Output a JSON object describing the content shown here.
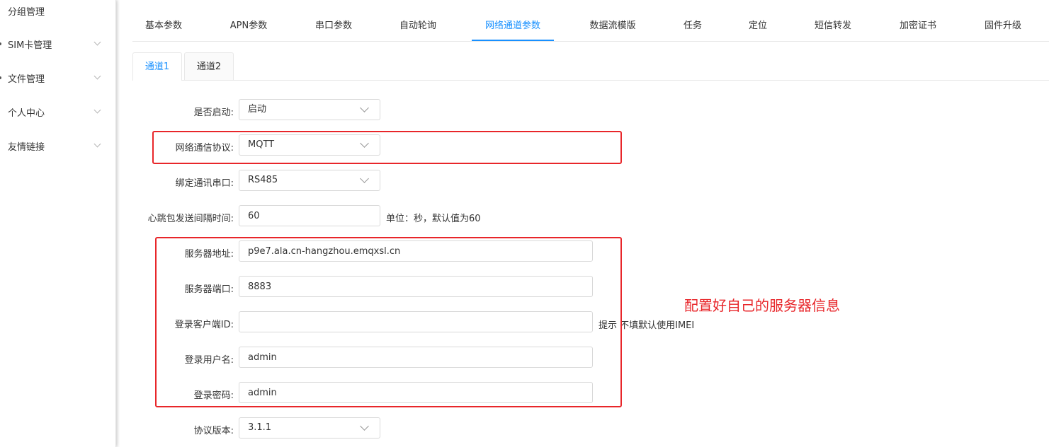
{
  "sidebar": {
    "items": [
      {
        "label": "分组管理"
      },
      {
        "label": "SIM卡管理"
      },
      {
        "label": "文件管理"
      },
      {
        "label": "个人中心"
      },
      {
        "label": "友情链接"
      }
    ]
  },
  "top_tabs": [
    "基本参数",
    "APN参数",
    "串口参数",
    "自动轮询",
    "网络通道参数",
    "数据流模版",
    "任务",
    "定位",
    "短信转发",
    "加密证书",
    "固件升级"
  ],
  "top_tabs_active": "网络通道参数",
  "sub_tabs": [
    "通道1",
    "通道2"
  ],
  "sub_tabs_active": "通道1",
  "form": {
    "enable": {
      "label": "是否启动:",
      "value": "启动"
    },
    "protocol": {
      "label": "网络通信协议:",
      "value": "MQTT"
    },
    "serial": {
      "label": "绑定通讯串口:",
      "value": "RS485"
    },
    "heartbeat": {
      "label": "心跳包发送间隔时间:",
      "value": "60",
      "hint": "单位：秒，默认值为60"
    },
    "server_addr": {
      "label": "服务器地址:",
      "value": "p9e7.ala.cn-hangzhou.emqxsl.cn"
    },
    "server_port": {
      "label": "服务器端口:",
      "value": "8883"
    },
    "client_id": {
      "label": "登录客户端ID:",
      "value": "",
      "hint": "提示 不填默认使用IMEI"
    },
    "username": {
      "label": "登录用户名:",
      "value": "admin"
    },
    "password": {
      "label": "登录密码:",
      "value": "admin"
    },
    "version": {
      "label": "协议版本:",
      "value": "3.1.1"
    }
  },
  "annotation": "配置好自己的服务器信息",
  "colors": {
    "accent": "#1890ff",
    "annotation_red": "#e8262a"
  }
}
